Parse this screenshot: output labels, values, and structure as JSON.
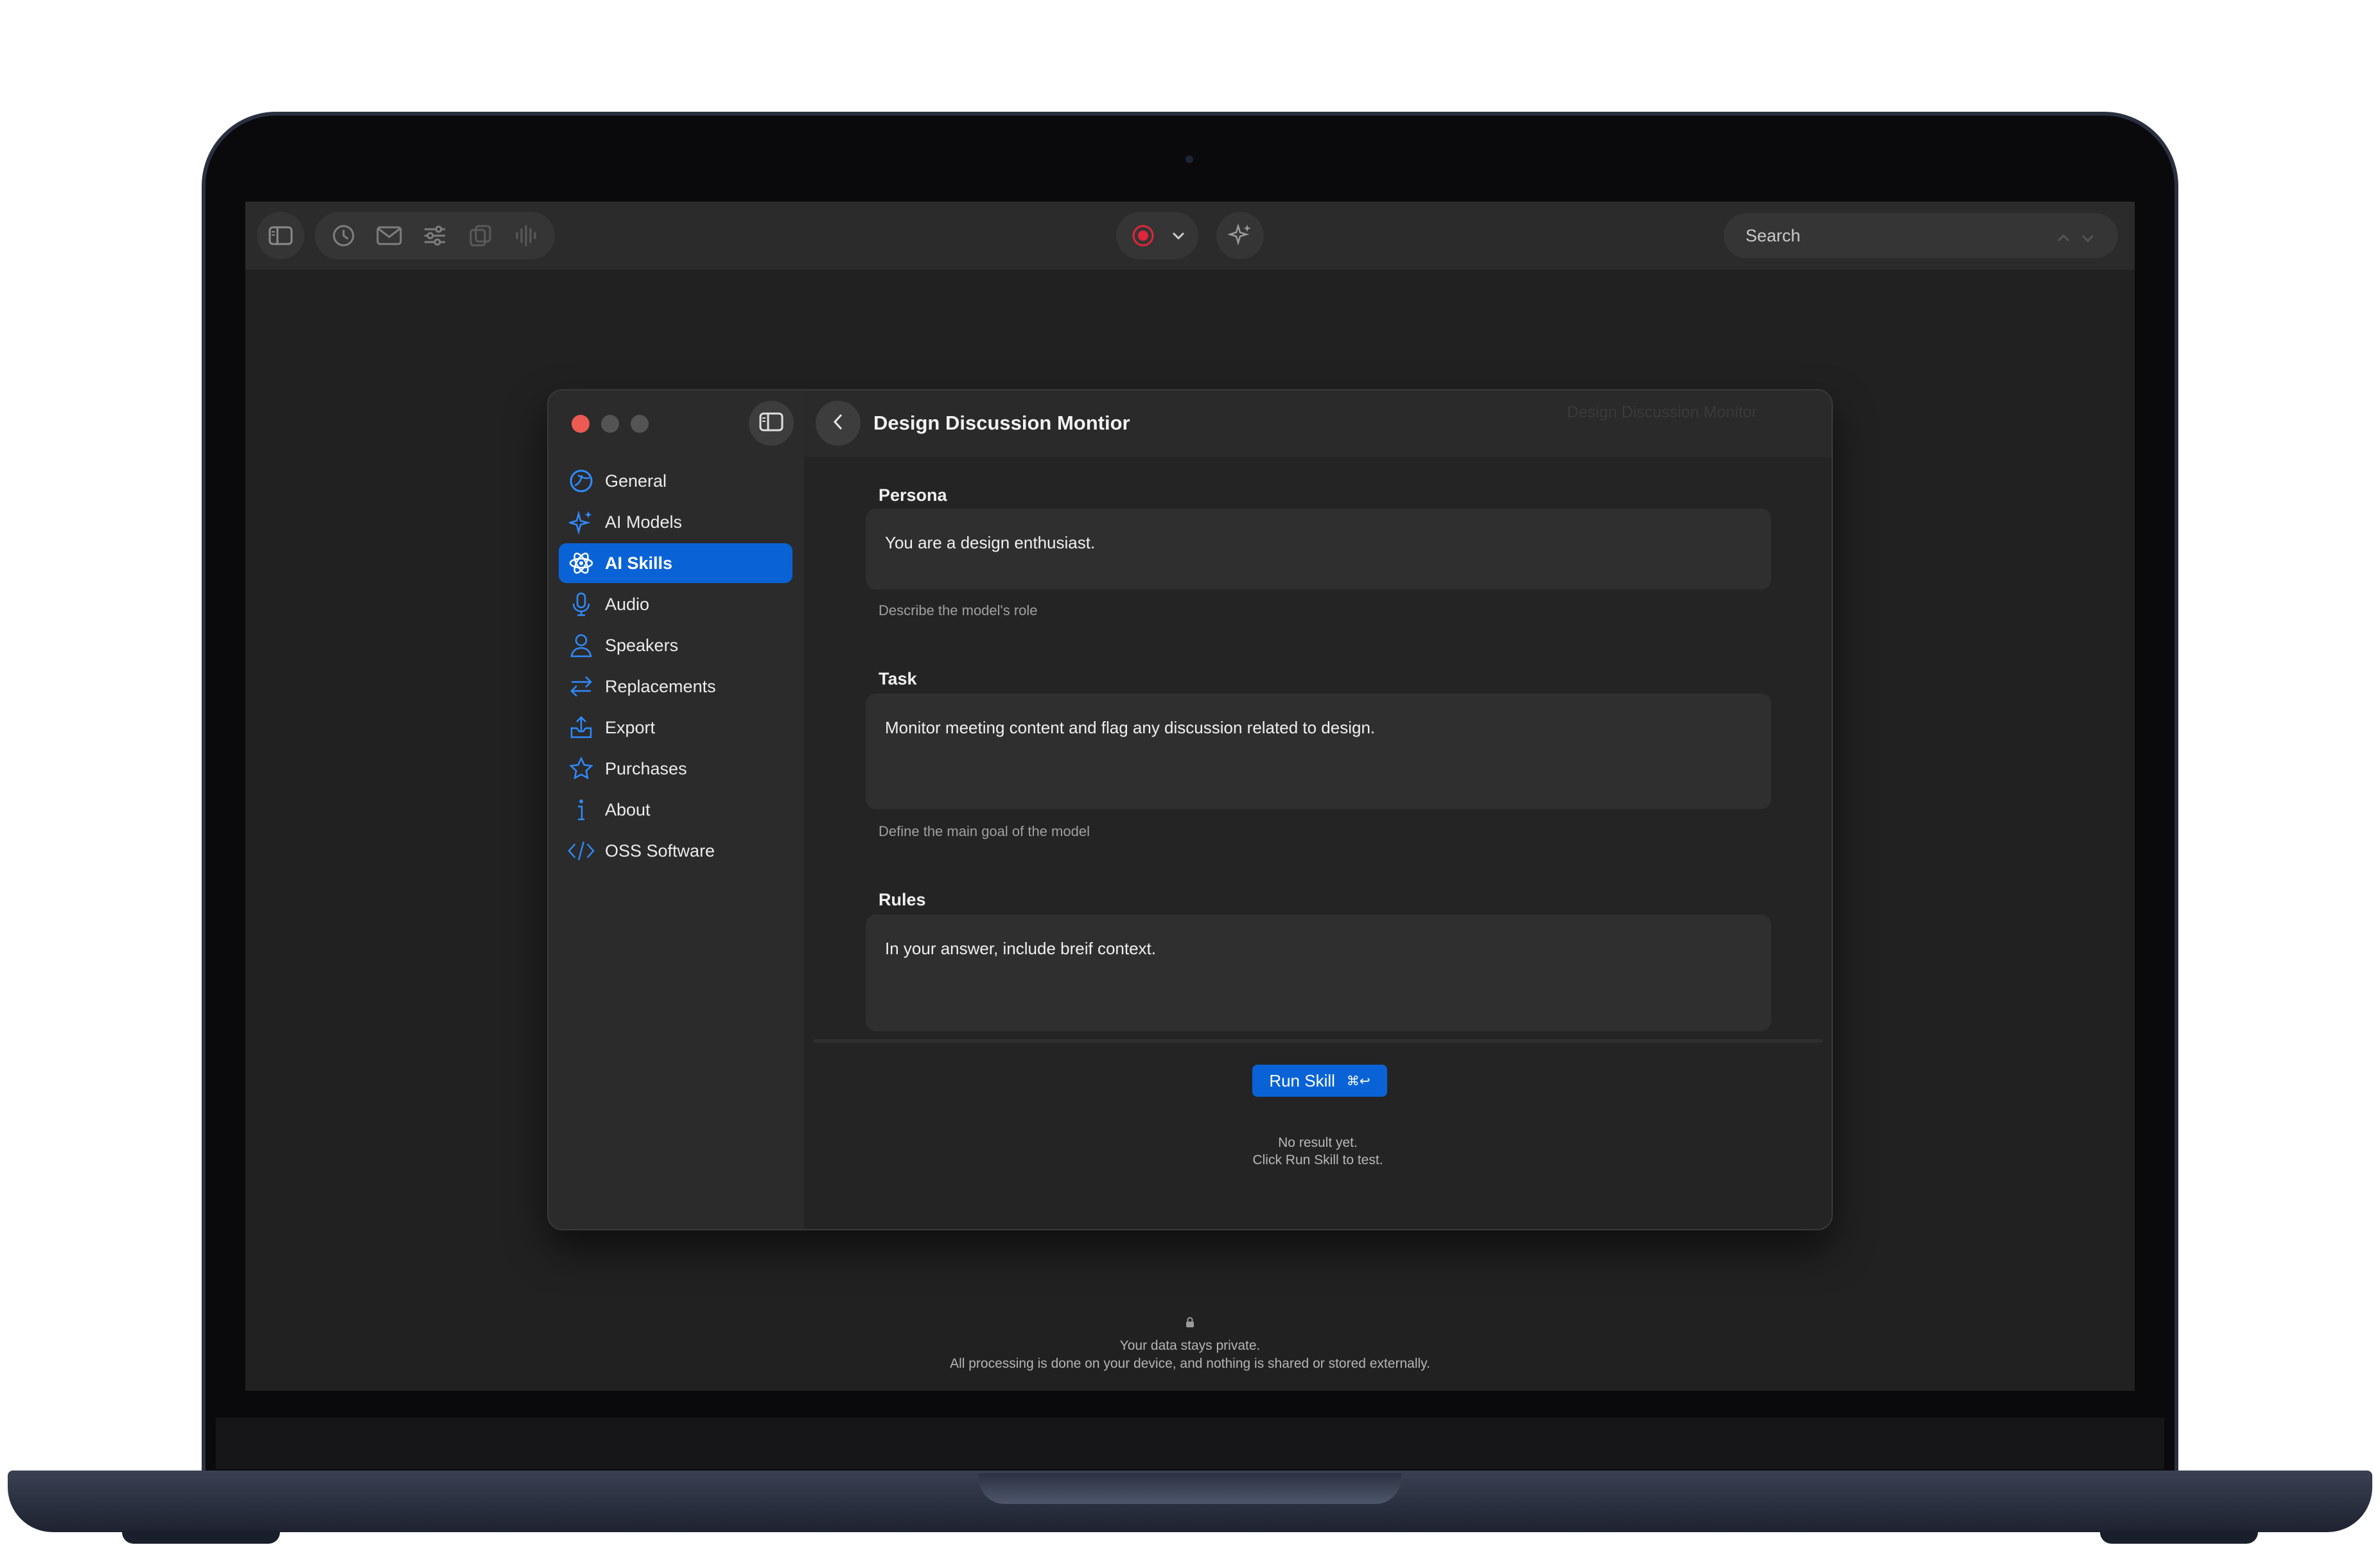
{
  "toolbar": {
    "icons": [
      "sidebar-toggle-icon",
      "clock-icon",
      "mail-icon",
      "sliders-icon",
      "copy-icon",
      "waveform-icon",
      "record-icon",
      "chevron-down-icon",
      "sparkle-icon"
    ],
    "search_placeholder": "Search"
  },
  "window": {
    "sidebar": {
      "items": [
        {
          "label": "General",
          "icon": "general-icon"
        },
        {
          "label": "AI Models",
          "icon": "sparkle-icon"
        },
        {
          "label": "AI Skills",
          "icon": "atom-icon",
          "active": true
        },
        {
          "label": "Audio",
          "icon": "microphone-icon"
        },
        {
          "label": "Speakers",
          "icon": "person-icon"
        },
        {
          "label": "Replacements",
          "icon": "arrows-swap-icon"
        },
        {
          "label": "Export",
          "icon": "export-icon"
        },
        {
          "label": "Purchases",
          "icon": "star-icon"
        },
        {
          "label": "About",
          "icon": "info-icon"
        },
        {
          "label": "OSS Software",
          "icon": "code-icon"
        }
      ]
    },
    "header": {
      "title": "Design Discussion Montior",
      "ghost_title": "Design Discussion Monitor"
    },
    "persona": {
      "label": "Persona",
      "value": "You are a design enthusiast.",
      "hint": "Describe the model's role"
    },
    "task": {
      "label": "Task",
      "value": "Monitor meeting content and flag any discussion related to design.",
      "hint": "Define the main goal of the model"
    },
    "rules": {
      "label": "Rules",
      "value": "In your answer, include breif context."
    },
    "run_button": {
      "label": "Run Skill",
      "shortcut": "⌘↩"
    },
    "result": {
      "line1": "No result yet.",
      "line2": "Click Run Skill to test."
    }
  },
  "privacy": {
    "line1": "Your data stays private.",
    "line2": "All processing is done on your device, and nothing is shared or stored externally."
  },
  "colors": {
    "accent": "#0a63d6",
    "record": "#e0263a",
    "close": "#ec5a52",
    "window_bg": "#262626",
    "screen_bg": "#212121"
  }
}
